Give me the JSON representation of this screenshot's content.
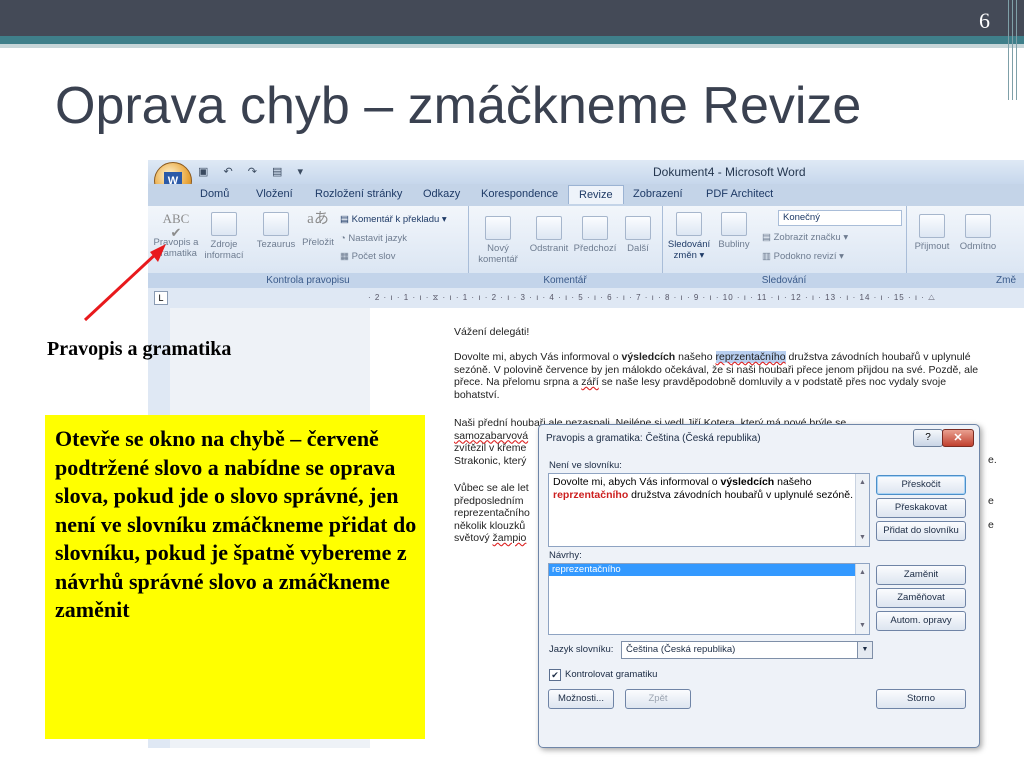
{
  "slide": {
    "number": "6",
    "title": "Oprava chyb – zmáčkneme Revize",
    "label": "Pravopis a gramatika",
    "note": "Otevře se okno na chybě – červeně podtržené slovo a nabídne se oprava slova, pokud jde o slovo správné, jen není ve slovníku zmáčkneme přidat do slovníku, pokud je špatně vybereme z návrhů správné slovo a zmáčkneme zaměnit"
  },
  "word": {
    "window_title": "Dokument4 - Microsoft Word",
    "tabs": [
      "Domů",
      "Vložení",
      "Rozložení stránky",
      "Odkazy",
      "Korespondence",
      "Revize",
      "Zobrazení",
      "PDF Architect"
    ],
    "active_tab": "Revize",
    "groups": {
      "proofing": {
        "label": "Kontrola pravopisu",
        "spelling_l1": "Pravopis a",
        "spelling_l2": "gramatika",
        "research_l1": "Zdroje",
        "research_l2": "informací",
        "thesaurus": "Tezaurus",
        "translate": "Přeložit",
        "translate_tip": "Komentář k překladu",
        "set_language": "Nastavit jazyk",
        "word_count": "Počet slov"
      },
      "comments": {
        "label": "Komentář",
        "new_l1": "Nový",
        "new_l2": "komentář",
        "delete": "Odstranit",
        "previous": "Předchozí",
        "next": "Další"
      },
      "tracking": {
        "label": "Sledování",
        "track_l1": "Sledování",
        "track_l2": "změn",
        "balloons": "Bubliny",
        "display": "Konečný",
        "show_markup": "Zobrazit značku",
        "reviewing_pane": "Podokno revizí"
      },
      "changes": {
        "label": "Změ",
        "accept": "Přijmout",
        "reject": "Odmítno"
      }
    },
    "ruler": "· 2 · ı · 1 · ı · ⧖ · ı · 1 · ı · 2 · ı · 3 · ı · 4 · ı · 5 · ı · 6 · ı · 7 · ı · 8 · ı · 9 · ı · 10 · ı · 11 · ı · 12 · ı · 13 · ı · 14 · ı · 15 · ı · △",
    "doc": {
      "greeting": "Vážení delegáti!",
      "p1_a": "Dovolte mi, abych Vás informoval o ",
      "p1_bold": "výsledcích",
      "p1_b": " našeho ",
      "p1_err": "reprzentačního",
      "p1_c": "  družstva závodních houbařů v uplynulé sezóně. V polovině července by jen málokdo očekával, že si naši houbaři přece jenom přijdou na své. Pozdě, ale přece. Na přelomu srpna a ",
      "p1_err2": "září",
      "p1_d": "  se naše lesy pravděpodobně domluvily a v podstatě přes noc vydaly svoje bohatství.",
      "p2_l1": "Naši přední houbaři ale nezaspali. Nejlépe si vedl Jiří Kotera, který má nové brýle se",
      "p2_l2": "samozabarvová",
      "p2_l3": "zvítězil v křeme",
      "p2_l4": "Strakonic, který",
      "p2_end": "e.",
      "p3_l1": "Vůbec se ale let",
      "p3_l2": "předposledním",
      "p3_l3": "reprezentačního",
      "p3_l4": "několik klouzků",
      "p3_l5": "světový ",
      "p3_l5_err": "žampio",
      "p3_r1": "e",
      "p3_r2": "e"
    }
  },
  "dialog": {
    "title": "Pravopis a gramatika: Čeština (Česká republika)",
    "help": "?",
    "close": "✕",
    "not_in_dict_label": "Není ve slovníku:",
    "sentence_a": "Dovolte mi, abych Vás informoval o ",
    "sentence_bold": "výsledcích",
    "sentence_b": " našeho ",
    "sentence_err": "reprzentačního",
    "sentence_c": " družstva závodních houbařů v uplynulé sezóně.",
    "suggestions_label": "Návrhy:",
    "suggestions": [
      "reprezentačního"
    ],
    "language_label": "Jazyk slovníku:",
    "language_value": "Čeština (Česká republika)",
    "check_grammar": "Kontrolovat gramatiku",
    "buttons": {
      "ignore_once": "Přeskočit",
      "ignore_all": "Přeskakovat",
      "add": "Přidat do slovníku",
      "change": "Zaměnit",
      "change_all": "Zaměňovat",
      "autocorrect": "Autom. opravy",
      "options": "Možnosti...",
      "undo": "Zpět",
      "cancel": "Storno"
    }
  },
  "colors": {
    "header_bar": "#444a57",
    "band": "#3f7f8a",
    "title_text": "#3a4150",
    "note_background": "#ffff00",
    "arrow": "#e8191c",
    "error_text": "#cc1f1f"
  }
}
